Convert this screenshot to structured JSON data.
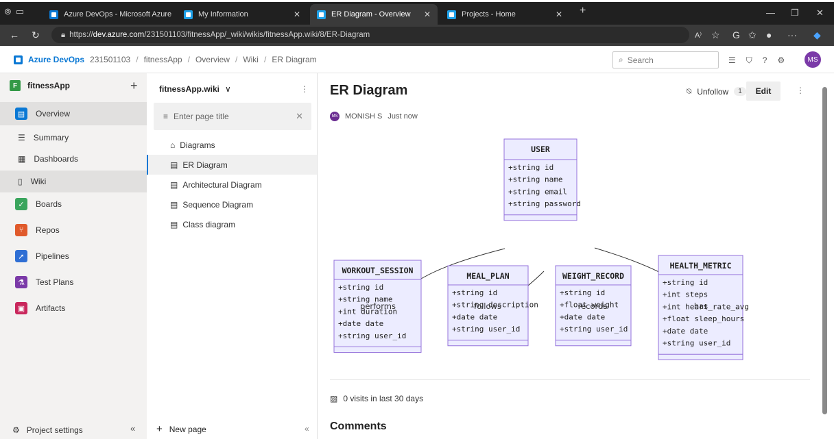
{
  "browser": {
    "tabs": [
      {
        "title": "Azure DevOps - Microsoft Azure"
      },
      {
        "title": "My Information"
      },
      {
        "title": "ER Diagram - Overview"
      },
      {
        "title": "Projects - Home"
      }
    ],
    "url_prefix": "https://",
    "url_host": "dev.azure.com",
    "url_path": "/231501103/fitnessApp/_wiki/wikis/fitnessApp.wiki/8/ER-Diagram"
  },
  "header": {
    "org_name": "Azure DevOps",
    "breadcrumbs": [
      "231501103",
      "fitnessApp",
      "Overview",
      "Wiki",
      "ER Diagram"
    ],
    "search_placeholder": "Search",
    "avatar_initials": "MS"
  },
  "nav": {
    "project_initial": "F",
    "project_name": "fitnessApp",
    "items": [
      {
        "label": "Overview",
        "color": "#0a78d4"
      },
      {
        "label": "Summary"
      },
      {
        "label": "Dashboards"
      },
      {
        "label": "Wiki"
      },
      {
        "label": "Boards",
        "color": "#3aa55d"
      },
      {
        "label": "Repos",
        "color": "#e05a2b"
      },
      {
        "label": "Pipelines",
        "color": "#2f6fd4"
      },
      {
        "label": "Test Plans",
        "color": "#7b3aa8"
      },
      {
        "label": "Artifacts",
        "color": "#c9275c"
      }
    ],
    "settings_label": "Project settings"
  },
  "wiki": {
    "title": "fitnessApp.wiki",
    "filter_placeholder": "Enter page title",
    "pages": [
      {
        "label": "Diagrams"
      },
      {
        "label": "ER Diagram"
      },
      {
        "label": "Architectural Diagram"
      },
      {
        "label": "Sequence Diagram"
      },
      {
        "label": "Class diagram"
      }
    ],
    "new_page_label": "New page"
  },
  "page": {
    "title": "ER Diagram",
    "unfollow_label": "Unfollow",
    "follower_count": "1",
    "edit_label": "Edit",
    "author_initials": "MS",
    "author": "MONISH S",
    "updated": "Just now",
    "visits": "0 visits in last 30 days",
    "comments_heading": "Comments"
  },
  "diagram": {
    "entities": [
      {
        "name": "USER",
        "fields": [
          "+string id",
          "+string name",
          "+string email",
          "+string password"
        ]
      },
      {
        "name": "WORKOUT_SESSION",
        "fields": [
          "+string id",
          "+string name",
          "+int duration",
          "+date date",
          "+string user_id"
        ]
      },
      {
        "name": "MEAL_PLAN",
        "fields": [
          "+string id",
          "+string description",
          "+date date",
          "+string user_id"
        ]
      },
      {
        "name": "WEIGHT_RECORD",
        "fields": [
          "+string id",
          "+float weight",
          "+date date",
          "+string user_id"
        ]
      },
      {
        "name": "HEALTH_METRIC",
        "fields": [
          "+string id",
          "+int steps",
          "+int heart_rate_avg",
          "+float sleep_hours",
          "+date date",
          "+string user_id"
        ]
      }
    ],
    "relations": [
      "performs",
      "follows",
      "records",
      "has"
    ],
    "fill": "#ececff",
    "stroke": "#9370db"
  }
}
